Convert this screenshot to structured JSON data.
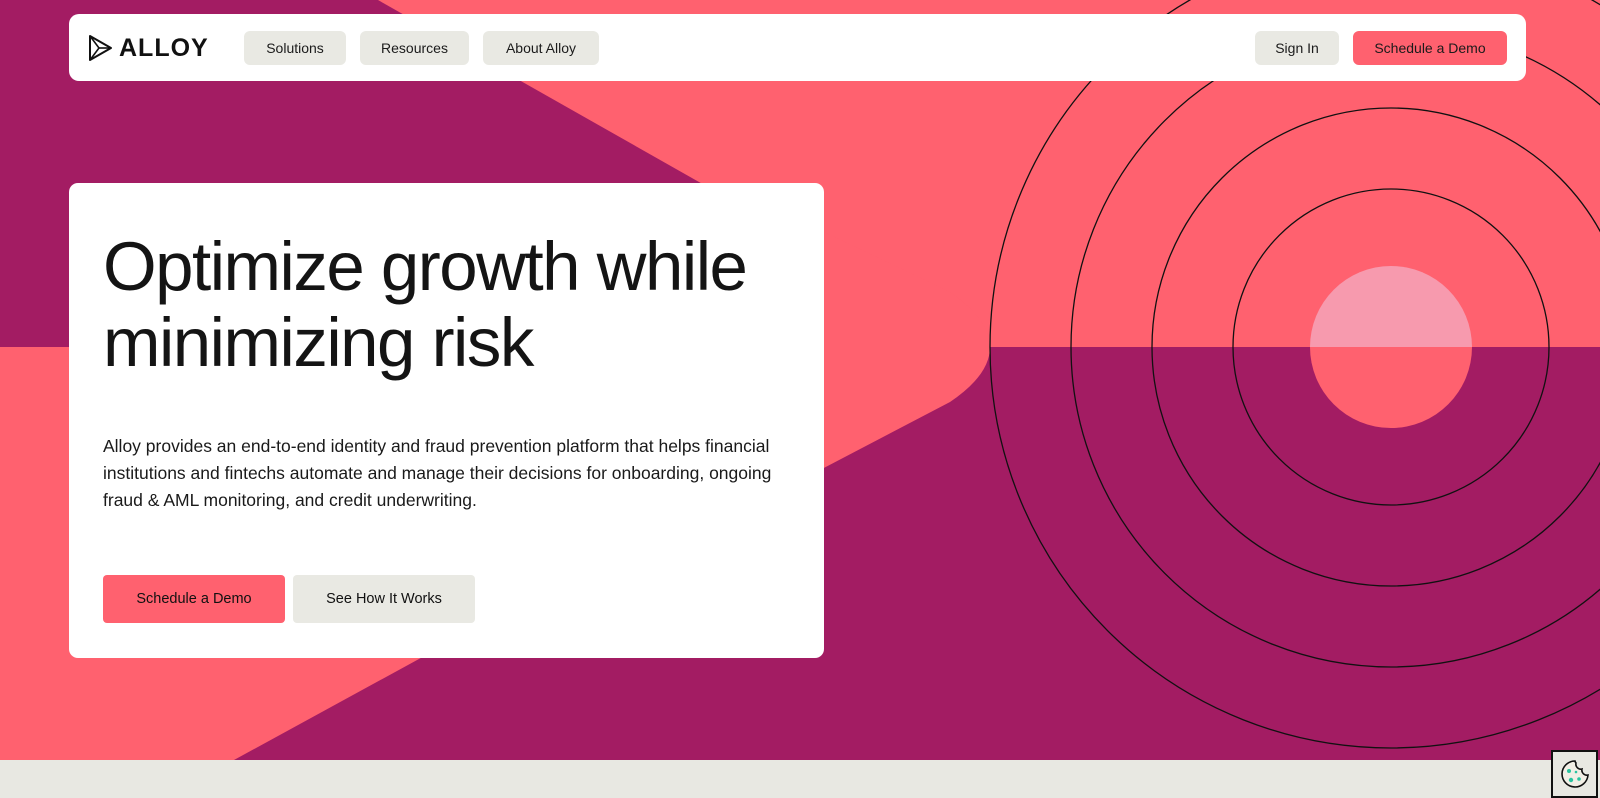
{
  "brand": {
    "name": "ALLOY",
    "logo_icon": "alloy-triangle-logo"
  },
  "nav": {
    "items": [
      {
        "label": "Solutions"
      },
      {
        "label": "Resources"
      },
      {
        "label": "About Alloy"
      }
    ],
    "sign_in": "Sign In",
    "cta": "Schedule a Demo"
  },
  "hero": {
    "headline": "Optimize growth while minimizing risk",
    "description": "Alloy provides an end-to-end identity and fraud prevention platform that helps financial institutions and fintechs automate and manage their decisions for onboarding, ongoing fraud & AML monitoring, and credit underwriting.",
    "primary_cta": "Schedule a Demo",
    "secondary_cta": "See How It Works"
  },
  "cookie_widget": {
    "icon": "cookie-icon"
  },
  "colors": {
    "coral": "#ff616f",
    "magenta": "#a31c63",
    "light_pink": "#f79aae",
    "off_white": "#e9e9e3"
  }
}
